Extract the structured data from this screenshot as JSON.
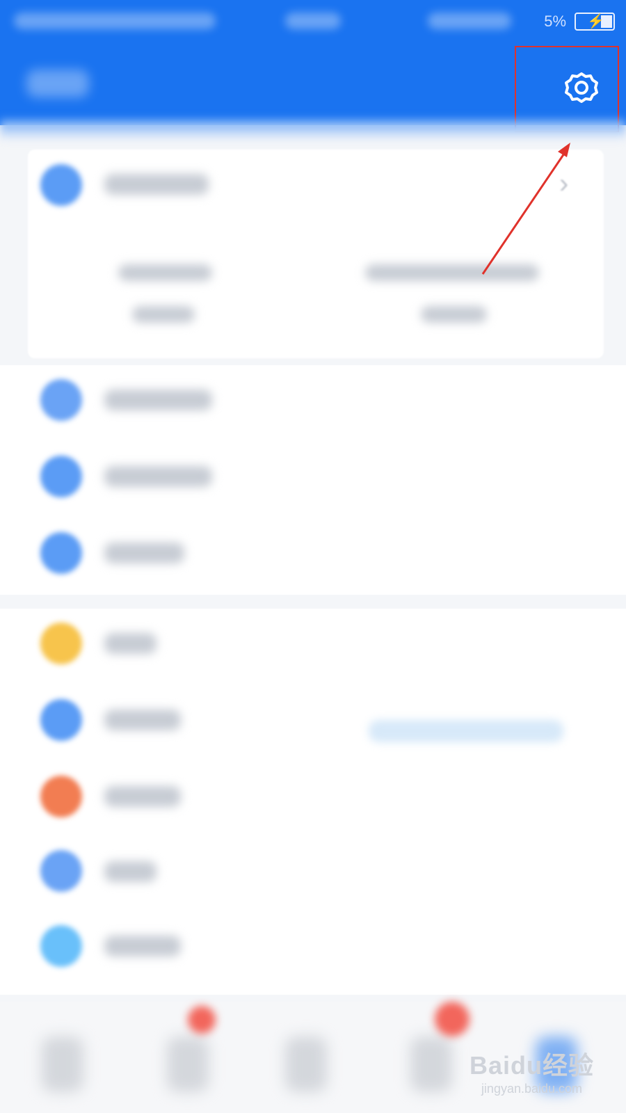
{
  "status_bar": {
    "battery_text": "5%"
  },
  "header": {
    "settings_icon": "gear-icon"
  },
  "colors": {
    "primary": "#1a73f0",
    "annotation": "#e0322b",
    "yellow": "#f7c44c",
    "orange": "#f27d52",
    "lightblue": "#69c0fa"
  },
  "watermark": {
    "line1": "Baidu经验",
    "line2": "jingyan.baidu.com"
  }
}
